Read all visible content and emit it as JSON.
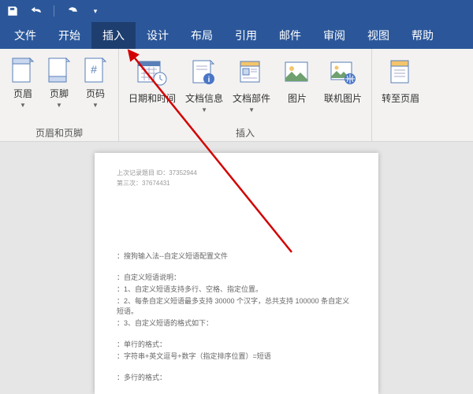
{
  "titlebar": {
    "save": "保存",
    "undo": "撤销",
    "redo": "重做"
  },
  "tabs": {
    "file": "文件",
    "home": "开始",
    "insert": "插入",
    "design": "设计",
    "layout": "布局",
    "references": "引用",
    "mailings": "邮件",
    "review": "审阅",
    "view": "视图",
    "help": "帮助"
  },
  "ribbon": {
    "group1": {
      "label": "页眉和页脚",
      "header": "页眉",
      "footer": "页脚",
      "pagenum": "页码"
    },
    "group2": {
      "label": "插入",
      "datetime": "日期和时间",
      "docinfo": "文档信息",
      "quickparts": "文档部件",
      "picture": "图片",
      "onlinepic": "联机图片"
    },
    "group3": {
      "goto": "转至页眉"
    }
  },
  "doc": {
    "hdr1": "上次记录题目 ID：37352944",
    "hdr2": "第三次：37674431",
    "l1": "：搜狗输入法--自定义短语配置文件",
    "l2": "：自定义短语说明：",
    "l3": "：1、自定义短语支持多行、空格、指定位置。",
    "l4": "：2、每条自定义短语最多支持 30000 个汉字，总共支持 100000 条自定义短语。",
    "l5": "：3、自定义短语的格式如下：",
    "l6": "：单行的格式：",
    "l7": "：字符串+英文逗号+数字（指定排序位置）=短语",
    "l8": "：多行的格式："
  }
}
